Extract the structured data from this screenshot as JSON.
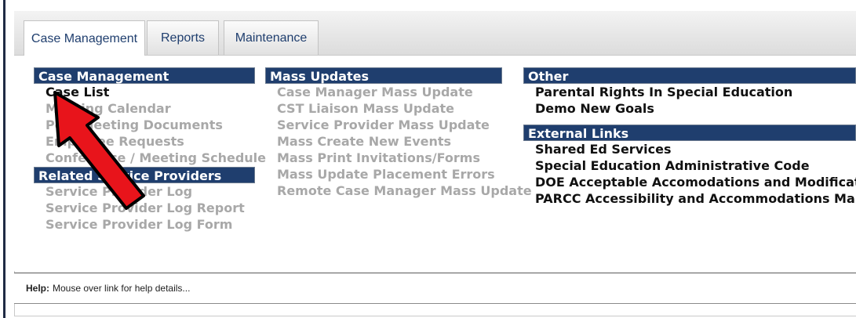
{
  "tabs": [
    {
      "label": "Case Management",
      "active": true
    },
    {
      "label": "Reports",
      "active": false
    },
    {
      "label": "Maintenance",
      "active": false
    }
  ],
  "columns": {
    "left": {
      "case_management": {
        "header": "Case Management",
        "links": [
          {
            "label": "Case List",
            "enabled": true
          },
          {
            "label": "Meeting Calendar",
            "enabled": false
          },
          {
            "label": "Post Meeting Documents",
            "enabled": false
          },
          {
            "label": "Employee Requests",
            "enabled": false
          },
          {
            "label": "Conference / Meeting Schedule",
            "enabled": false
          }
        ]
      },
      "related_service_providers": {
        "header": "Related Service Providers",
        "links": [
          {
            "label": "Service Provider Log",
            "enabled": false
          },
          {
            "label": "Service Provider Log Report",
            "enabled": false
          },
          {
            "label": "Service Provider Log Form",
            "enabled": false
          }
        ]
      }
    },
    "middle": {
      "mass_updates": {
        "header": "Mass Updates",
        "links": [
          {
            "label": "Case Manager Mass Update",
            "enabled": false
          },
          {
            "label": "CST Liaison Mass Update",
            "enabled": false
          },
          {
            "label": "Service Provider Mass Update",
            "enabled": false
          },
          {
            "label": "Mass Create New Events",
            "enabled": false
          },
          {
            "label": "Mass Print Invitations/Forms",
            "enabled": false
          },
          {
            "label": "Mass Update Placement Errors",
            "enabled": false
          },
          {
            "label": "Remote Case Manager Mass Update",
            "enabled": false
          }
        ]
      }
    },
    "right": {
      "other": {
        "header": "Other",
        "links": [
          {
            "label": "Parental Rights In Special Education",
            "enabled": true
          },
          {
            "label": "Demo New Goals",
            "enabled": true
          }
        ]
      },
      "external_links": {
        "header": "External Links",
        "links": [
          {
            "label": "Shared Ed Services",
            "enabled": true
          },
          {
            "label": "Special Education Administrative Code",
            "enabled": true
          },
          {
            "label": "DOE Acceptable Accomodations and Modifications",
            "enabled": true
          },
          {
            "label": "PARCC Accessibility and Accommodations Manual",
            "enabled": true
          }
        ]
      }
    }
  },
  "help": {
    "label": "Help:",
    "text": "Mouse over link for help details..."
  },
  "colors": {
    "header_bg": "#1f3e6e",
    "disabled_link": "#a8a8a8",
    "annotation_arrow": "#e8141b"
  }
}
